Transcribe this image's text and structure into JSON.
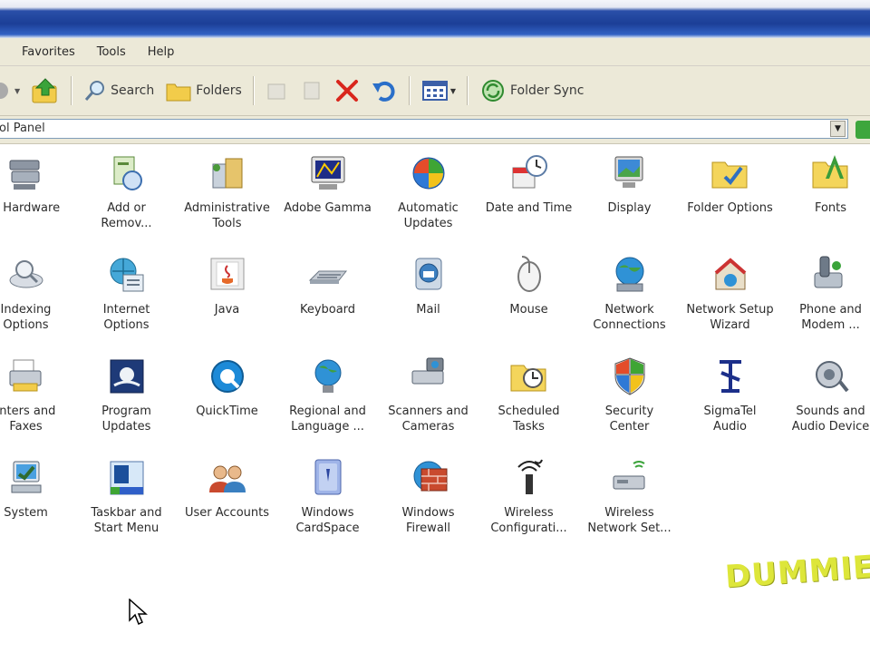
{
  "menu": [
    "Favorites",
    "Tools",
    "Help"
  ],
  "toolbar": {
    "search_label": "Search",
    "folders_label": "Folders",
    "folder_sync_label": "Folder Sync"
  },
  "address": {
    "value": "ol Panel"
  },
  "items": [
    {
      "label": "d Hardware",
      "icon": "add-hardware-icon"
    },
    {
      "label": "Add or\nRemov...",
      "icon": "add-remove-programs-icon"
    },
    {
      "label": "Administrative\nTools",
      "icon": "administrative-tools-icon"
    },
    {
      "label": "Adobe Gamma",
      "icon": "adobe-gamma-icon"
    },
    {
      "label": "Automatic\nUpdates",
      "icon": "automatic-updates-icon"
    },
    {
      "label": "Date and Time",
      "icon": "date-time-icon"
    },
    {
      "label": "Display",
      "icon": "display-icon"
    },
    {
      "label": "Folder Options",
      "icon": "folder-options-icon"
    },
    {
      "label": "Fonts",
      "icon": "fonts-icon"
    },
    {
      "label": "Indexing\nOptions",
      "icon": "indexing-options-icon"
    },
    {
      "label": "Internet\nOptions",
      "icon": "internet-options-icon"
    },
    {
      "label": "Java",
      "icon": "java-icon"
    },
    {
      "label": "Keyboard",
      "icon": "keyboard-icon"
    },
    {
      "label": "Mail",
      "icon": "mail-icon"
    },
    {
      "label": "Mouse",
      "icon": "mouse-icon"
    },
    {
      "label": "Network\nConnections",
      "icon": "network-connections-icon"
    },
    {
      "label": "Network Setup\nWizard",
      "icon": "network-setup-wizard-icon"
    },
    {
      "label": "Phone and\nModem ...",
      "icon": "phone-modem-icon"
    },
    {
      "label": "inters and\nFaxes",
      "icon": "printers-faxes-icon"
    },
    {
      "label": "Program\nUpdates",
      "icon": "program-updates-icon"
    },
    {
      "label": "QuickTime",
      "icon": "quicktime-icon"
    },
    {
      "label": "Regional and\nLanguage ...",
      "icon": "regional-language-icon"
    },
    {
      "label": "Scanners and\nCameras",
      "icon": "scanners-cameras-icon"
    },
    {
      "label": "Scheduled\nTasks",
      "icon": "scheduled-tasks-icon"
    },
    {
      "label": "Security\nCenter",
      "icon": "security-center-icon"
    },
    {
      "label": "SigmaTel\nAudio",
      "icon": "sigmatel-audio-icon"
    },
    {
      "label": "Sounds and\nAudio Device",
      "icon": "sounds-audio-icon"
    },
    {
      "label": "System",
      "icon": "system-icon"
    },
    {
      "label": "Taskbar and\nStart Menu",
      "icon": "taskbar-start-menu-icon"
    },
    {
      "label": "User Accounts",
      "icon": "user-accounts-icon"
    },
    {
      "label": "Windows\nCardSpace",
      "icon": "windows-cardspace-icon"
    },
    {
      "label": "Windows\nFirewall",
      "icon": "windows-firewall-icon"
    },
    {
      "label": "Wireless\nConfigurati...",
      "icon": "wireless-configuration-icon"
    },
    {
      "label": "Wireless\nNetwork Set...",
      "icon": "wireless-network-setup-icon"
    }
  ],
  "watermark": "DUMMIES",
  "colors": {
    "title_bar": "#1c3f97",
    "chrome": "#ece9d8",
    "watermark": "#dde63a"
  }
}
